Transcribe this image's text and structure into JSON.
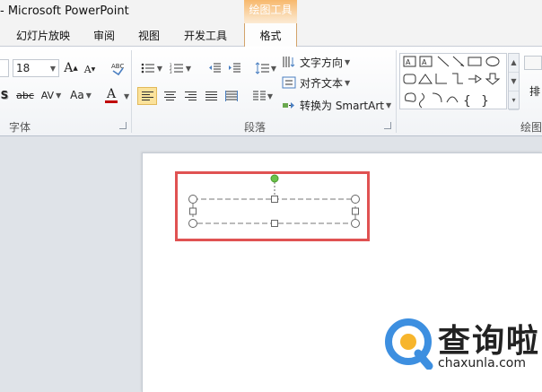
{
  "title_bar": {
    "title": "- Microsoft PowerPoint"
  },
  "tabs": [
    {
      "label": "幻灯片放映"
    },
    {
      "label": "审阅"
    },
    {
      "label": "视图"
    },
    {
      "label": "开发工具"
    }
  ],
  "context_group": {
    "label": "绘图工具",
    "tab": "格式",
    "color": "#f5a24b"
  },
  "ribbon": {
    "font": {
      "size_value": "18",
      "grow_label": "A",
      "shrink_label": "A",
      "shadow_label": "S",
      "strike_label": "abc",
      "spacing_label": "AV",
      "case_label": "Aa",
      "color_label": "A",
      "font_color": "#c00000",
      "group_label": "字体"
    },
    "paragraph": {
      "text_direction_label": "文字方向",
      "align_text_label": "对齐文本",
      "smartart_label": "转换为 SmartArt",
      "group_label": "段落"
    },
    "drawing": {
      "arrange_label": "排",
      "group_label": "绘图"
    }
  },
  "watermark": {
    "text": "查询啦",
    "url": "chaxunla.com"
  }
}
